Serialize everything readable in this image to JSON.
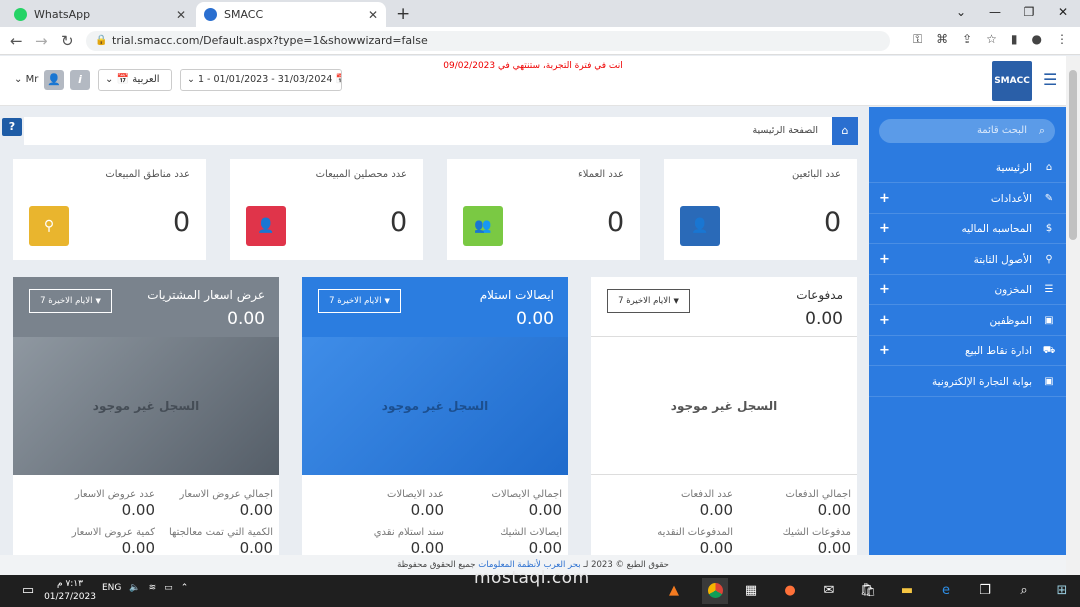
{
  "browser": {
    "tabs": [
      {
        "label": "WhatsApp"
      },
      {
        "label": "SMACC"
      }
    ],
    "new_tab": "+",
    "url": "trial.smacc.com/Default.aspx?type=1&showwizard=false"
  },
  "header": {
    "trial_notice": "انت في فترة التجربة، ستنتهي في 09/02/2023",
    "user": "Mr",
    "info": "i",
    "language": "العربية",
    "date_range": "1 - 01/01/2023 - 31/03/2024",
    "logo": "SMACC"
  },
  "sidebar": {
    "search_placeholder": "البحث قائمة",
    "items": [
      {
        "label": "الرئيسية",
        "icon": "home-icon",
        "glyph": "⌂",
        "expandable": false
      },
      {
        "label": "الأعدادات",
        "icon": "wrench-icon",
        "glyph": "✎",
        "expandable": true
      },
      {
        "label": "المحاسبه الماليه",
        "icon": "dollar-icon",
        "glyph": "$",
        "expandable": true
      },
      {
        "label": "الأصول الثابتة",
        "icon": "pin-icon",
        "glyph": "⚲",
        "expandable": true
      },
      {
        "label": "المخزون",
        "icon": "list-icon",
        "glyph": "☰",
        "expandable": true
      },
      {
        "label": "الموظفين",
        "icon": "money-icon",
        "glyph": "▣",
        "expandable": true
      },
      {
        "label": "ادارة نقاط البيع",
        "icon": "cart-icon",
        "glyph": "⛟",
        "expandable": true
      },
      {
        "label": "بوابة التجارة الإلكترونية",
        "icon": "money-icon",
        "glyph": "▣",
        "expandable": false
      }
    ]
  },
  "breadcrumb": {
    "label": "الصفحة الرئيسية"
  },
  "help": "?",
  "stats": [
    {
      "title": "عدد البائعين",
      "value": "0",
      "color": "#2a6ab8",
      "icon": "user-icon"
    },
    {
      "title": "عدد العملاء",
      "value": "0",
      "color": "#7ac943",
      "icon": "users-icon"
    },
    {
      "title": "عدد محصلين المبيعات",
      "value": "0",
      "color": "#e0344a",
      "icon": "user-icon"
    },
    {
      "title": "عدد مناطق المبيعات",
      "value": "0",
      "color": "#e9b52e",
      "icon": "map-marker-icon"
    }
  ],
  "cards": [
    {
      "title": "مدفوعات",
      "amount": "0.00",
      "period": "7 الايام الاخيرة",
      "empty": "السجل غير موجود",
      "metrics": [
        {
          "label": "اجمالي الدفعات",
          "value": "0.00"
        },
        {
          "label": "عدد الدفعات",
          "value": "0.00"
        },
        {
          "label": "مدفوعات الشيك",
          "value": "0.00"
        },
        {
          "label": "المدفوعات النقديه",
          "value": "0.00"
        }
      ]
    },
    {
      "title": "ايصالات استلام",
      "amount": "0.00",
      "period": "7 الايام الاخيرة",
      "empty": "السجل غير موجود",
      "metrics": [
        {
          "label": "اجمالي الايصالات",
          "value": "0.00"
        },
        {
          "label": "عدد الايصالات",
          "value": "0.00"
        },
        {
          "label": "ايصالات الشيك",
          "value": "0.00"
        },
        {
          "label": "سند استلام نقدي",
          "value": "0.00"
        }
      ]
    },
    {
      "title": "عرض اسعار المشتريات",
      "amount": "0.00",
      "period": "7 الايام الاخيرة",
      "empty": "السجل غير موجود",
      "metrics": [
        {
          "label": "اجمالي عروض الاسعار",
          "value": "0.00"
        },
        {
          "label": "عدد عروض الاسعار",
          "value": "0.00"
        },
        {
          "label": "الكمية التي تمت معالجتها",
          "value": "0.00"
        },
        {
          "label": "كمية عروض الاسعار",
          "value": "0.00"
        }
      ]
    }
  ],
  "footer": {
    "prefix": "حقوق الطبع © 2023 لـ",
    "link": "بحر العرب لأنظمة المعلومات",
    "suffix": "جميع الحقوق محفوظة"
  },
  "taskbar": {
    "time": "٧:١٣ م",
    "date": "01/27/2023",
    "lang": "ENG"
  },
  "watermark": "mostaql.com"
}
